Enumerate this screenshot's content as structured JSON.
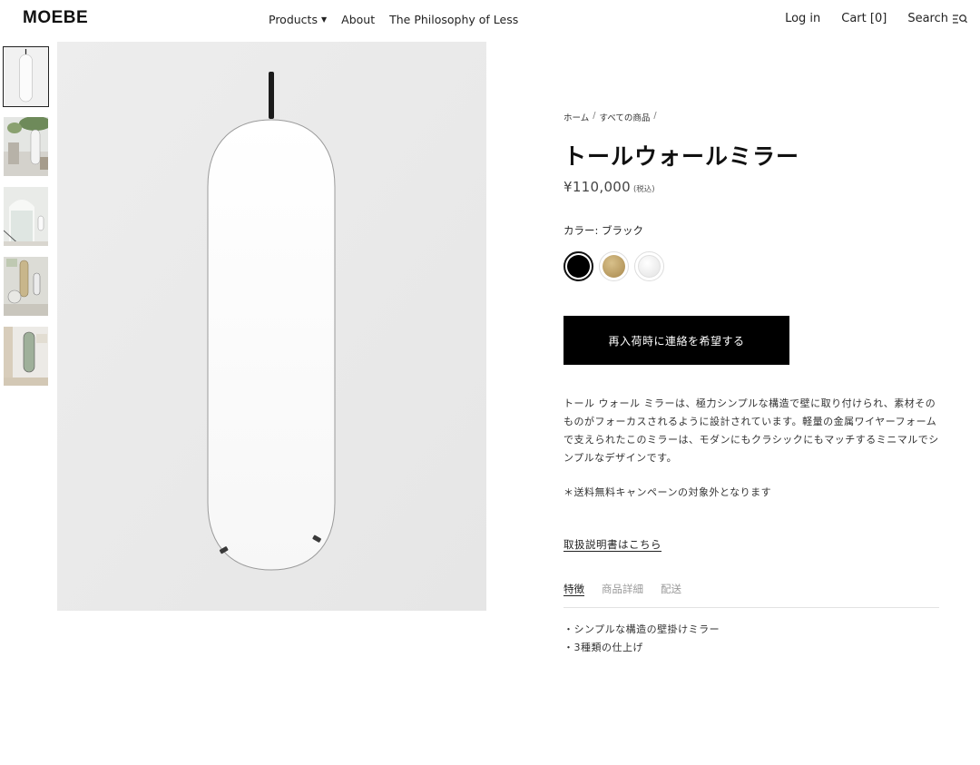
{
  "header": {
    "logo": "MOEBE",
    "nav": [
      {
        "label": "Products",
        "caret": "▼"
      },
      {
        "label": "About"
      },
      {
        "label": "The Philosophy of Less"
      }
    ],
    "login": "Log in",
    "cart_label": "Cart",
    "cart_count": "[0]",
    "search": "Search"
  },
  "thumbnails": [
    "mirror-front",
    "room-plants",
    "arched-window-room",
    "wall-mirrors",
    "room-curtain"
  ],
  "product": {
    "breadcrumb": [
      "ホーム",
      "すべての商品"
    ],
    "breadcrumb_sep": "/",
    "title": "トールウォールミラー",
    "price": "¥110,000",
    "tax": "(税込)",
    "color_label": "カラー: ブラック",
    "swatches": [
      {
        "name": "ブラック",
        "color": "#000000",
        "selected": true
      },
      {
        "name": "ブラス",
        "color": "#b99d61",
        "selected": false
      },
      {
        "name": "ホワイト",
        "color": "#ededed",
        "selected": false
      }
    ],
    "cta": "再入荷時に連絡を希望する",
    "description": "トール ウォール ミラーは、極力シンプルな構造で壁に取り付けられ、素材そのものがフォーカスされるように設計されています。軽量の金属ワイヤーフォームで支えられたこのミラーは、モダンにもクラシックにもマッチするミニマルでシンプルなデザインです。",
    "note": "＊送料無料キャンペーンの対象外となります",
    "manual_link": "取扱説明書はこちら",
    "tabs": [
      "特徴",
      "商品詳細",
      "配送"
    ],
    "features": [
      "・シンプルな構造の壁掛けミラー",
      "・3種類の仕上げ"
    ]
  }
}
